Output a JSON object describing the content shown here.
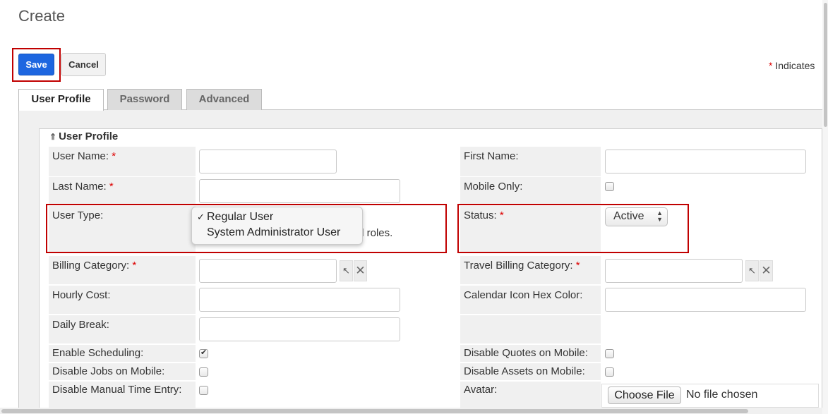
{
  "page": {
    "title": "Create"
  },
  "toolbar": {
    "save_label": "Save",
    "cancel_label": "Cancel"
  },
  "required_note": {
    "star": "*",
    "text": "Indicates"
  },
  "tabs": [
    {
      "label": "User Profile",
      "active": true
    },
    {
      "label": "Password",
      "active": false
    },
    {
      "label": "Advanced",
      "active": false
    }
  ],
  "section": {
    "title": "User Profile",
    "toggle_icon": "double-chevron-up-icon"
  },
  "fields": {
    "user_name": {
      "label": "User Name:",
      "required": true,
      "value": ""
    },
    "first_name": {
      "label": "First Name:",
      "required": false,
      "value": ""
    },
    "last_name": {
      "label": "Last Name:",
      "required": true,
      "value": ""
    },
    "mobile_only": {
      "label": "Mobile Only:",
      "checked": false
    },
    "user_type": {
      "label": "User Type:",
      "options": [
        "Regular User",
        "System Administrator User"
      ],
      "selected": "Regular User",
      "description": "ecords based on team security and roles."
    },
    "status": {
      "label": "Status:",
      "required": true,
      "value": "Active"
    },
    "billing_category": {
      "label": "Billing Category:",
      "required": true,
      "value": ""
    },
    "travel_billing_category": {
      "label": "Travel Billing Category:",
      "required": true,
      "value": ""
    },
    "hourly_cost": {
      "label": "Hourly Cost:",
      "value": ""
    },
    "calendar_icon_hex_color": {
      "label": "Calendar Icon Hex Color:",
      "value": ""
    },
    "daily_break": {
      "label": "Daily Break:",
      "value": ""
    },
    "enable_scheduling": {
      "label": "Enable Scheduling:",
      "checked": true
    },
    "disable_quotes_on_mobile": {
      "label": "Disable Quotes on Mobile:",
      "checked": false
    },
    "disable_jobs_on_mobile": {
      "label": "Disable Jobs on Mobile:",
      "checked": false
    },
    "disable_assets_on_mobile": {
      "label": "Disable Assets on Mobile:",
      "checked": false
    },
    "disable_manual_time_entry": {
      "label": "Disable Manual Time Entry:",
      "checked": false
    },
    "avatar": {
      "label": "Avatar:",
      "button_label": "Choose File",
      "status": "No file chosen"
    }
  },
  "colors": {
    "save_blue": "#1d66e0",
    "highlight_red": "#c00000",
    "required_red": "#dd0000"
  }
}
